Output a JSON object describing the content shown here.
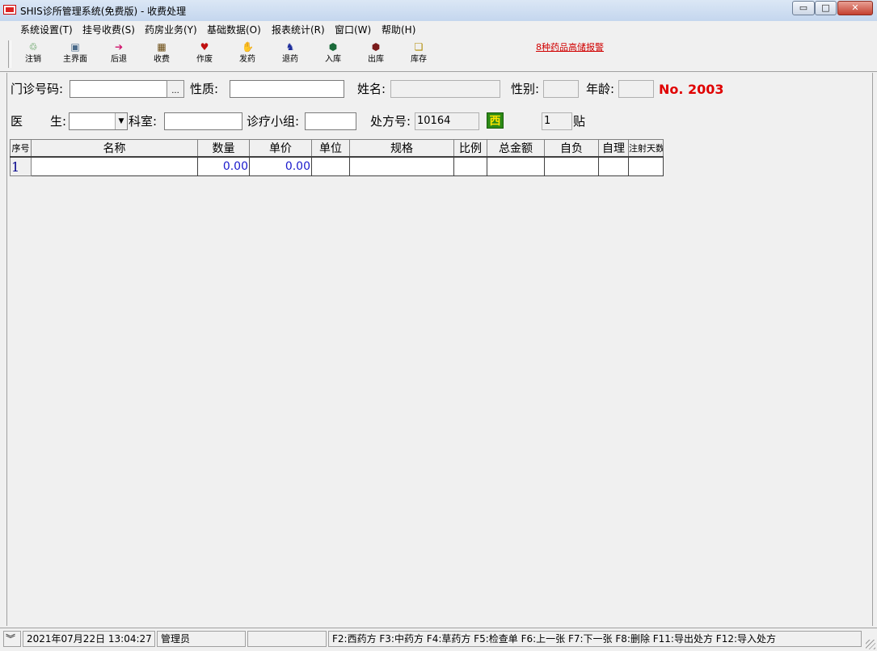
{
  "window": {
    "title": "SHIS诊所管理系统(免费版) - 收费处理",
    "min_glyph": "▭",
    "max_glyph": "□",
    "close_glyph": "✕"
  },
  "menu": [
    "系统设置(T)",
    "挂号收费(S)",
    "药房业务(Y)",
    "基础数据(O)",
    "报表统计(R)",
    "窗口(W)",
    "帮助(H)"
  ],
  "toolbar": {
    "buttons": [
      {
        "label": "注销",
        "icon": "logout-icon",
        "glyph": "♲",
        "color": "#1a7a1a"
      },
      {
        "label": "主界面",
        "icon": "home-icon",
        "glyph": "▣",
        "color": "#4a6a8a"
      },
      {
        "label": "后退",
        "icon": "back-arrow-icon",
        "glyph": "➔",
        "color": "#d0106a"
      },
      {
        "label": "收费",
        "icon": "charge-icon",
        "glyph": "▦",
        "color": "#6a4a10"
      },
      {
        "label": "作废",
        "icon": "void-icon",
        "glyph": "♥",
        "color": "#c01010"
      },
      {
        "label": "发药",
        "icon": "dispense-icon",
        "glyph": "✋",
        "color": "#444"
      },
      {
        "label": "退药",
        "icon": "return-drug-icon",
        "glyph": "♞",
        "color": "#1a2a9a"
      },
      {
        "label": "入库",
        "icon": "stock-in-icon",
        "glyph": "⬢",
        "color": "#1a6a3a"
      },
      {
        "label": "出库",
        "icon": "stock-out-icon",
        "glyph": "⬢",
        "color": "#7a1a1a"
      },
      {
        "label": "库存",
        "icon": "inventory-icon",
        "glyph": "❏",
        "color": "#b08a00"
      }
    ],
    "alert_link": "8种药品高储报警"
  },
  "form": {
    "clinic_no_label": "门诊号码:",
    "clinic_no_value": "",
    "ellipsis": "...",
    "nature_label": "性质:",
    "nature_value": "",
    "name_label": "姓名:",
    "name_value": "",
    "gender_label": "性别:",
    "gender_value": "",
    "age_label": "年龄:",
    "age_value": "",
    "rx_number": "No. 2003",
    "doctor_label_a": "医",
    "doctor_label_b": "生:",
    "doctor_value": "",
    "dept_label": "科室:",
    "dept_value": "",
    "team_label": "诊疗小组:",
    "team_value": "",
    "rx_no_label": "处方号:",
    "rx_no_value": "10164",
    "west_badge": "西",
    "doses_value": "1",
    "doses_unit": "贴"
  },
  "grid": {
    "headers": [
      "序号",
      "名称",
      "数量",
      "单价",
      "单位",
      "规格",
      "比例",
      "总金额",
      "自负",
      "自理",
      "注射天数"
    ],
    "rows": [
      {
        "seq": "1",
        "name": "",
        "qty": "0.00",
        "price": "0.00",
        "unit": "",
        "spec": "",
        "ratio": "",
        "total": "",
        "self_pay": "",
        "self_care": "",
        "inject_days": ""
      }
    ]
  },
  "status": {
    "datetime": "2021年07月22日 13:04:27",
    "user": "管理员",
    "empty": "",
    "shortcuts": "F2:西药方 F3:中药方 F4:草药方 F5:检查单 F6:上一张 F7:下一张 F8:删除 F11:导出处方 F12:导入处方"
  }
}
